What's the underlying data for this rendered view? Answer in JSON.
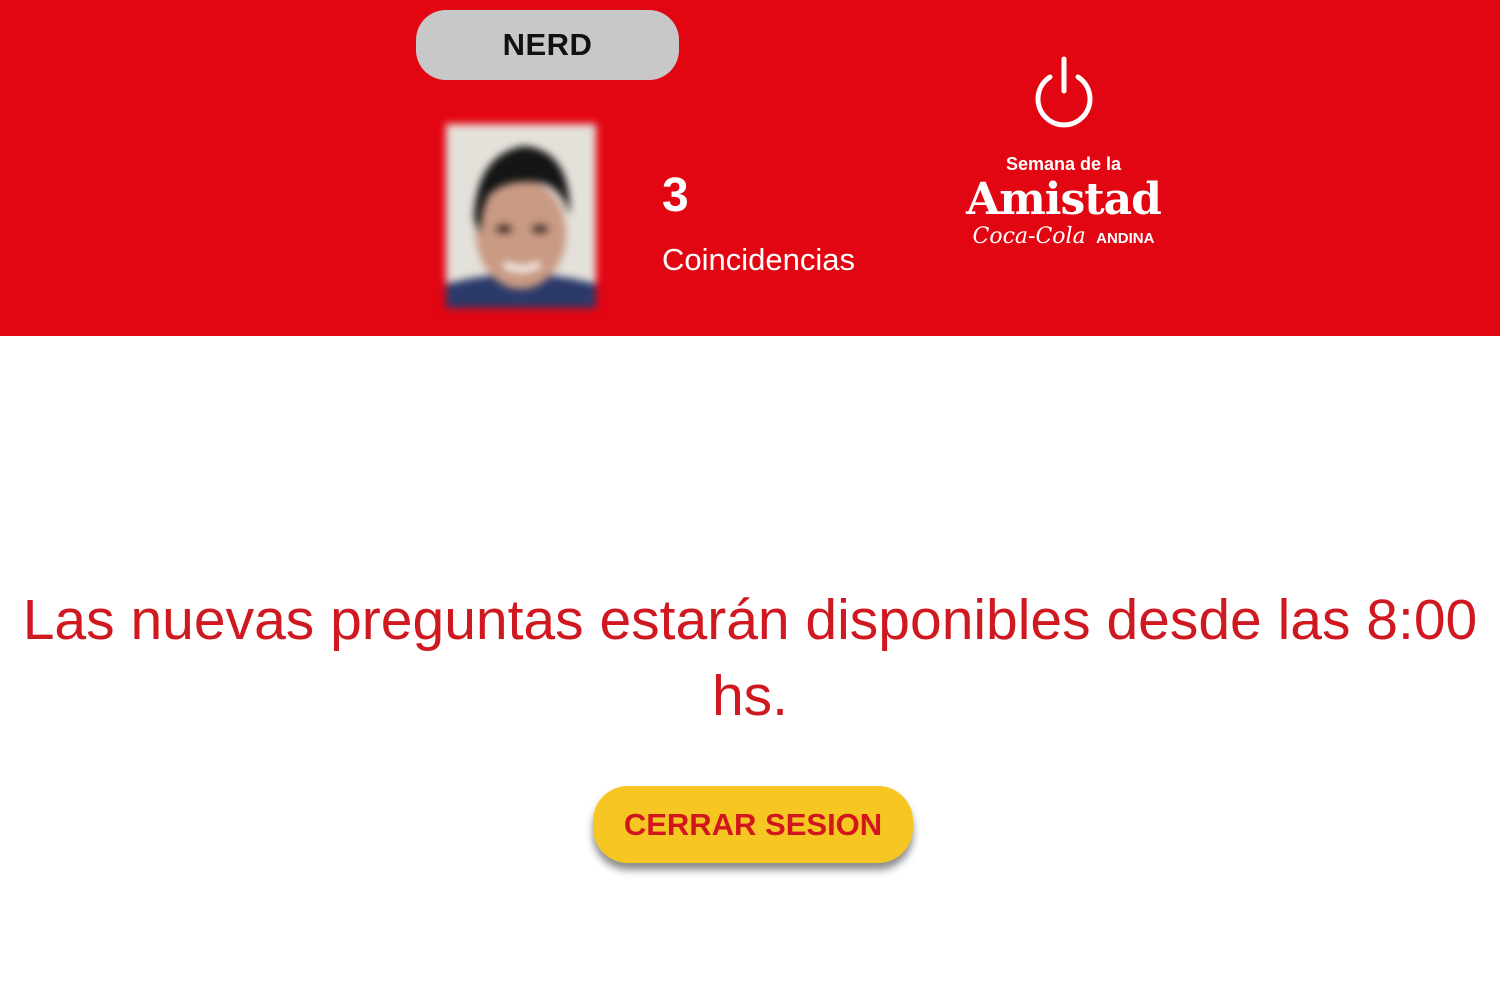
{
  "header": {
    "profile_badge": "NERD",
    "matches": {
      "count": "3",
      "label": "Coincidencias"
    },
    "logo": {
      "line1": "Semana de la",
      "line2": "Amistad",
      "brand": "Coca-Cola",
      "company": "ANDINA"
    },
    "power_icon": "power-icon"
  },
  "main": {
    "message": "Las nuevas preguntas estarán disponibles desde las 8:00 hs.",
    "logout_label": "CERRAR SESION"
  },
  "colors": {
    "header_bg": "#e20613",
    "message_text": "#d01820",
    "button_bg": "#f6c722",
    "button_text": "#d2161d",
    "badge_bg": "#c8c8c8"
  }
}
